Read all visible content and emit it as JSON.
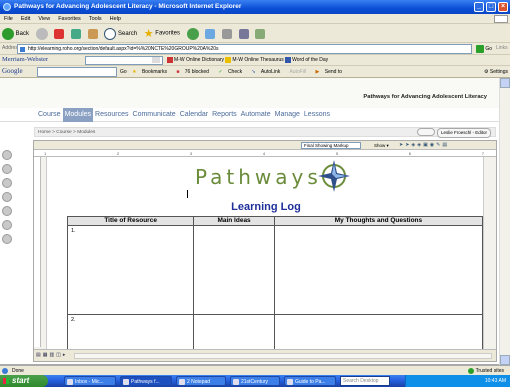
{
  "window": {
    "title": "Pathways for Advancing Adolescent Literacy - Microsoft Internet Explorer"
  },
  "menu": [
    "File",
    "Edit",
    "View",
    "Favorites",
    "Tools",
    "Help"
  ],
  "toolbar": {
    "back": "Back",
    "search": "Search",
    "favorites": "Favorites"
  },
  "address": {
    "label": "Address",
    "url": "http://elearning.roho.org/section/default.aspx?id=%%20NCTE%20GROUP%20A%20s",
    "go": "Go",
    "links": "Links"
  },
  "mw_bar": {
    "brand": "Merriam-Webster",
    "online_dictionary": "M-W Online Dictionary",
    "online_thesaurus": "M-W Online Thesaurus",
    "word_of_day": "Word of the Day"
  },
  "google_bar": {
    "brand": "Google",
    "go": "Go",
    "bookmarks": "Bookmarks",
    "blocked": "76 blocked",
    "check": "Check",
    "autolink": "AutoLink",
    "autofill": "AutoFill",
    "sendto": "Send to",
    "settings": "Settings"
  },
  "site": {
    "title": "Pathways for Advancing Adolescent Literacy",
    "nav": [
      "Course",
      "Modules",
      "Resources",
      "Communicate",
      "Calendar",
      "Reports",
      "Automate",
      "Manage",
      "Lessons"
    ],
    "active_nav": "Modules",
    "breadcrumb": "Home > Course > Modules",
    "user": "Leslie Froeschl - Editor"
  },
  "editor": {
    "markup_view": "Final Showing Markup",
    "show": "Show",
    "ruler": [
      "1",
      "2",
      "3",
      "4",
      "5",
      "6",
      "7"
    ]
  },
  "document": {
    "logo_text": "Pathways",
    "title": "Learning Log",
    "columns": [
      "Title of Resource",
      "Main Ideas",
      "My Thoughts and Questions"
    ],
    "rows": [
      {
        "num": "1."
      },
      {
        "num": "2."
      }
    ]
  },
  "status": {
    "text": "Done",
    "zone": "Trusted sites"
  },
  "taskbar": {
    "start": "start",
    "tasks": [
      "Inbox - Mic...",
      "Pathways f...",
      "2 Notepad",
      "21stCentury",
      "Guide to Pa..."
    ],
    "search_placeholder": "Search Desktop",
    "clock": "10:43 AM"
  }
}
